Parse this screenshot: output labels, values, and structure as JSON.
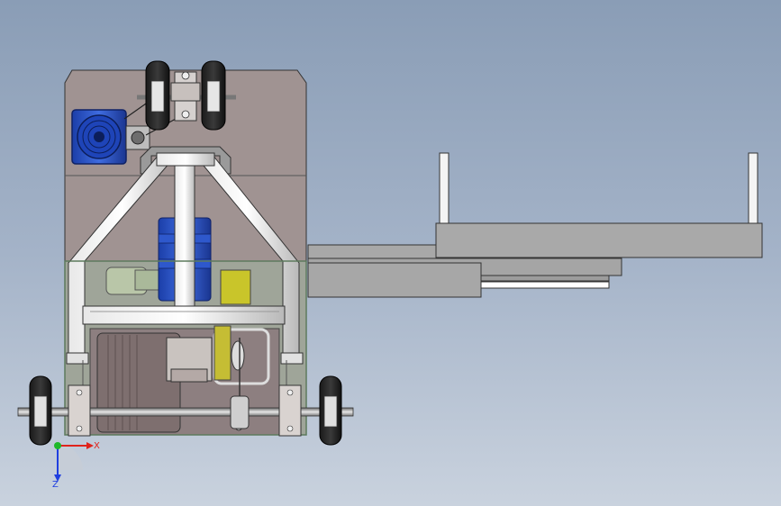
{
  "viewport": {
    "background_top": "#8a9db6",
    "background_bottom": "#c9d2de"
  },
  "triad": {
    "x_label": "X",
    "z_label": "Z",
    "x_color": "#e0231b",
    "y_color": "#1fb82a",
    "z_color": "#1f3fe0"
  },
  "components": [
    "chassis-body",
    "drive-motor",
    "upper-wheels",
    "tubular-frame",
    "blue-cylinder",
    "guard-panel",
    "rear-axle",
    "rear-wheels",
    "extension-arms"
  ]
}
